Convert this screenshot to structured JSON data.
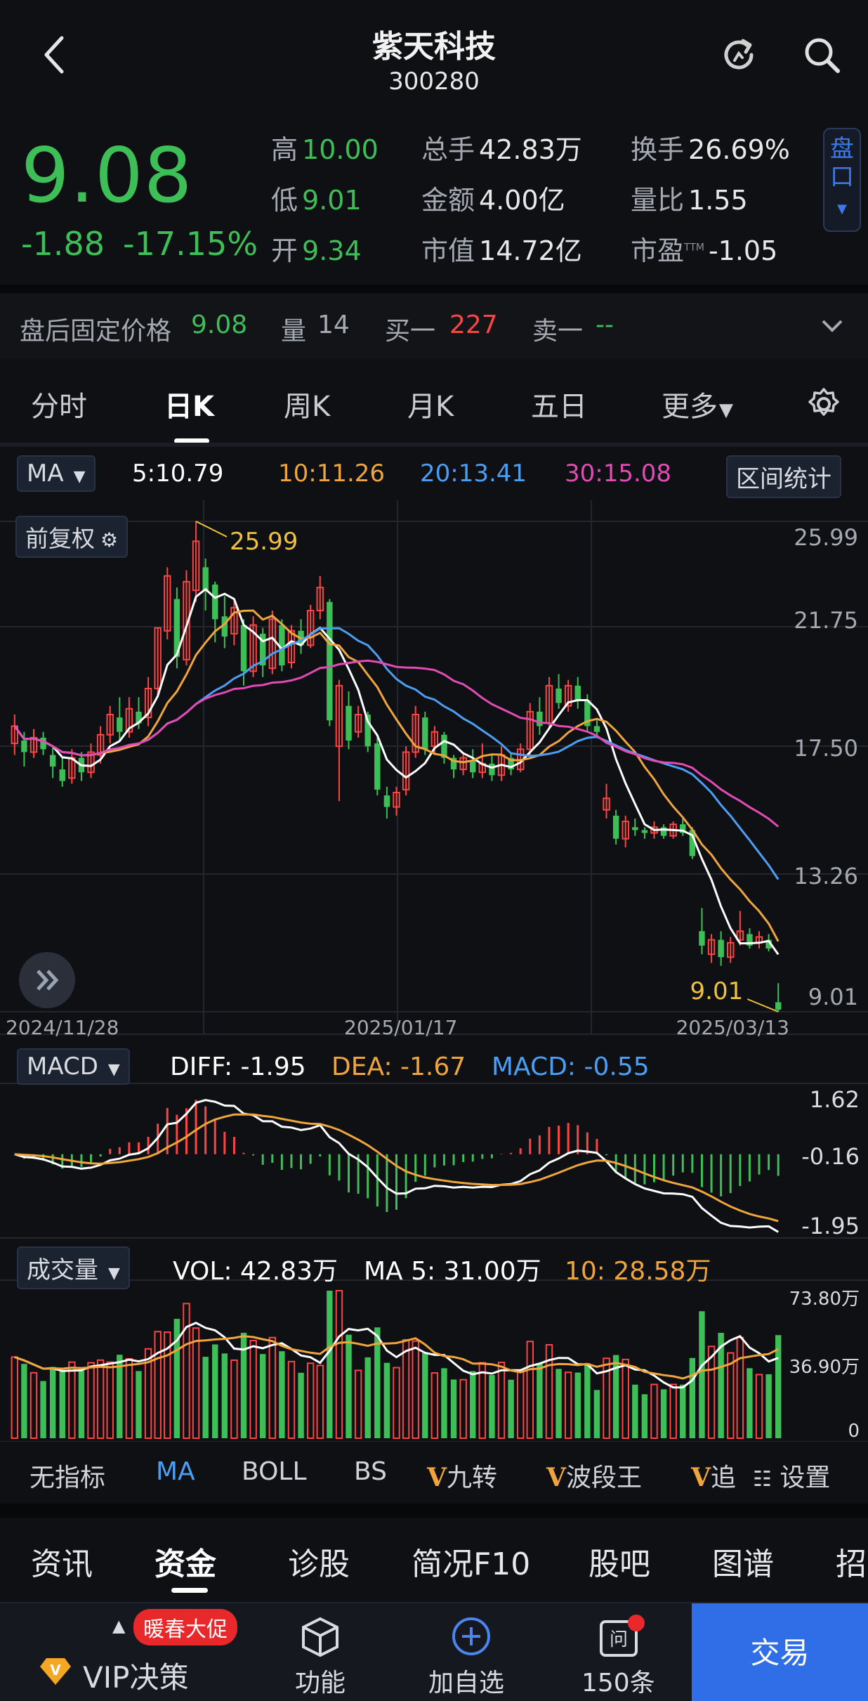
{
  "nav": {
    "title": "紫天科技",
    "code": "300280"
  },
  "quote": {
    "price": "9.08",
    "change": "-1.88",
    "change_pct": "-17.15%",
    "high_label": "高",
    "high": "10.00",
    "low_label": "低",
    "low": "9.01",
    "open_label": "开",
    "open": "9.34",
    "vol_label": "总手",
    "vol": "42.83万",
    "amount_label": "金额",
    "amount": "4.00亿",
    "mcap_label": "市值",
    "mcap": "14.72亿",
    "turnover_label": "换手",
    "turnover": "26.69%",
    "ratio_label": "量比",
    "ratio": "1.55",
    "pe_label": "市盈",
    "pe_sup": "TTM",
    "pe": "-1.05",
    "pankou": "盘口"
  },
  "after_hours": {
    "label": "盘后固定价格",
    "price": "9.08",
    "vol_label": "量",
    "vol": "14",
    "buy_label": "买一",
    "buy": "227",
    "sell_label": "卖一",
    "sell": "--"
  },
  "tabs": [
    "分时",
    "日K",
    "周K",
    "月K",
    "五日",
    "更多"
  ],
  "ma_row": {
    "selector": "MA",
    "ma5": "5:10.79",
    "ma10": "10:11.26",
    "ma20": "20:13.41",
    "ma30": "30:15.08",
    "range_btn": "区间统计"
  },
  "kline": {
    "adjust": "前复权",
    "max_label": "25.99",
    "min_label": "9.01",
    "y_ticks": [
      "25.99",
      "21.75",
      "17.50",
      "13.26",
      "9.01"
    ],
    "dates": [
      "2024/11/28",
      "2025/01/17",
      "2025/03/13"
    ]
  },
  "macd": {
    "selector": "MACD",
    "diff": "DIFF: -1.95",
    "dea": "DEA: -1.67",
    "macd": "MACD: -0.55",
    "ticks": [
      "1.62",
      "-0.16",
      "-1.95"
    ]
  },
  "volume": {
    "selector": "成交量",
    "vol": "VOL: 42.83万",
    "ma5": "MA 5: 31.00万",
    "ma10": "10: 28.58万",
    "ticks": [
      "73.80万",
      "36.90万",
      "0"
    ]
  },
  "indicators": [
    "无指标",
    "MA",
    "BOLL",
    "BS",
    "九转",
    "波段王",
    "追",
    "设置"
  ],
  "indicator_prefix": "V",
  "footer_tabs": [
    "资讯",
    "资金",
    "诊股",
    "简况F10",
    "股吧",
    "图谱",
    "招"
  ],
  "bottom_bar": {
    "vip": "VIP决策",
    "promo": "暖春大促",
    "func": "功能",
    "add": "加自选",
    "news": "150条",
    "trade": "交易"
  },
  "colors": {
    "up": "#ff4444",
    "down": "#3dbe57",
    "ma5": "#ffffff",
    "ma10": "#f0a53c",
    "ma20": "#4a9ff5",
    "ma30": "#e34bb4",
    "accent": "#2f6ee6"
  },
  "chart_data": {
    "type": "candlestick",
    "ylim": [
      9.01,
      25.99
    ],
    "candles": [
      {
        "o": 18.3,
        "c": 18.9,
        "h": 19.3,
        "l": 17.9
      },
      {
        "o": 18.4,
        "c": 18.0,
        "h": 18.7,
        "l": 17.5
      },
      {
        "o": 18.0,
        "c": 18.5,
        "h": 18.8,
        "l": 17.8
      },
      {
        "o": 18.5,
        "c": 18.1,
        "h": 18.7,
        "l": 17.9
      },
      {
        "o": 17.9,
        "c": 17.5,
        "h": 18.2,
        "l": 17.1
      },
      {
        "o": 17.4,
        "c": 17.0,
        "h": 17.8,
        "l": 16.8
      },
      {
        "o": 17.1,
        "c": 17.8,
        "h": 18.1,
        "l": 16.9
      },
      {
        "o": 17.8,
        "c": 17.3,
        "h": 18.0,
        "l": 17.0
      },
      {
        "o": 17.3,
        "c": 18.0,
        "h": 18.3,
        "l": 17.1
      },
      {
        "o": 17.9,
        "c": 18.6,
        "h": 18.9,
        "l": 17.6
      },
      {
        "o": 18.6,
        "c": 19.3,
        "h": 19.6,
        "l": 18.3
      },
      {
        "o": 19.2,
        "c": 18.7,
        "h": 19.9,
        "l": 18.4
      },
      {
        "o": 18.7,
        "c": 19.5,
        "h": 19.9,
        "l": 18.5
      },
      {
        "o": 19.4,
        "c": 19.0,
        "h": 19.9,
        "l": 18.8
      },
      {
        "o": 19.2,
        "c": 20.2,
        "h": 20.6,
        "l": 18.9
      },
      {
        "o": 20.2,
        "c": 22.3,
        "h": 22.3,
        "l": 20.0
      },
      {
        "o": 22.2,
        "c": 24.1,
        "h": 24.4,
        "l": 21.9
      },
      {
        "o": 23.3,
        "c": 21.3,
        "h": 23.7,
        "l": 20.9
      },
      {
        "o": 21.2,
        "c": 23.9,
        "h": 24.3,
        "l": 21.0
      },
      {
        "o": 23.6,
        "c": 25.3,
        "h": 25.99,
        "l": 23.2
      },
      {
        "o": 24.4,
        "c": 23.6,
        "h": 24.7,
        "l": 22.9
      },
      {
        "o": 23.8,
        "c": 22.6,
        "h": 23.9,
        "l": 21.8
      },
      {
        "o": 22.7,
        "c": 22.0,
        "h": 23.4,
        "l": 21.6
      },
      {
        "o": 22.1,
        "c": 23.0,
        "h": 23.3,
        "l": 21.7
      },
      {
        "o": 22.4,
        "c": 20.8,
        "h": 22.6,
        "l": 20.3
      },
      {
        "o": 20.8,
        "c": 22.4,
        "h": 22.7,
        "l": 20.6
      },
      {
        "o": 22.1,
        "c": 21.0,
        "h": 22.3,
        "l": 20.6
      },
      {
        "o": 20.9,
        "c": 22.6,
        "h": 22.9,
        "l": 20.7
      },
      {
        "o": 22.4,
        "c": 21.0,
        "h": 22.6,
        "l": 20.8
      },
      {
        "o": 21.1,
        "c": 22.2,
        "h": 22.4,
        "l": 20.9
      },
      {
        "o": 22.2,
        "c": 21.7,
        "h": 22.6,
        "l": 21.4
      },
      {
        "o": 21.7,
        "c": 22.9,
        "h": 23.1,
        "l": 21.6
      },
      {
        "o": 22.9,
        "c": 23.7,
        "h": 24.1,
        "l": 22.6
      },
      {
        "o": 23.2,
        "c": 19.1,
        "h": 23.3,
        "l": 18.9
      },
      {
        "o": 18.2,
        "c": 20.3,
        "h": 20.5,
        "l": 16.3
      },
      {
        "o": 19.6,
        "c": 18.4,
        "h": 20.1,
        "l": 18.1
      },
      {
        "o": 18.7,
        "c": 19.3,
        "h": 19.6,
        "l": 18.5
      },
      {
        "o": 19.3,
        "c": 18.2,
        "h": 19.4,
        "l": 18.0
      },
      {
        "o": 18.3,
        "c": 16.7,
        "h": 18.5,
        "l": 16.5
      },
      {
        "o": 16.5,
        "c": 16.1,
        "h": 16.8,
        "l": 15.7
      },
      {
        "o": 16.1,
        "c": 16.6,
        "h": 16.8,
        "l": 15.8
      },
      {
        "o": 16.7,
        "c": 18.0,
        "h": 18.2,
        "l": 16.5
      },
      {
        "o": 18.0,
        "c": 19.3,
        "h": 19.6,
        "l": 17.8
      },
      {
        "o": 19.2,
        "c": 18.1,
        "h": 19.4,
        "l": 17.9
      },
      {
        "o": 18.2,
        "c": 18.7,
        "h": 18.9,
        "l": 17.9
      },
      {
        "o": 18.6,
        "c": 17.8,
        "h": 18.7,
        "l": 17.6
      },
      {
        "o": 17.8,
        "c": 17.4,
        "h": 17.9,
        "l": 17.1
      },
      {
        "o": 17.4,
        "c": 17.8,
        "h": 18.0,
        "l": 17.2
      },
      {
        "o": 17.7,
        "c": 17.3,
        "h": 18.1,
        "l": 17.1
      },
      {
        "o": 17.3,
        "c": 17.6,
        "h": 18.3,
        "l": 17.1
      },
      {
        "o": 17.6,
        "c": 17.2,
        "h": 17.9,
        "l": 17.0
      },
      {
        "o": 17.2,
        "c": 17.9,
        "h": 18.2,
        "l": 17.0
      },
      {
        "o": 17.8,
        "c": 17.4,
        "h": 18.0,
        "l": 17.2
      },
      {
        "o": 17.4,
        "c": 18.1,
        "h": 18.3,
        "l": 17.3
      },
      {
        "o": 18.1,
        "c": 19.4,
        "h": 19.7,
        "l": 17.9
      },
      {
        "o": 19.4,
        "c": 18.9,
        "h": 19.9,
        "l": 18.6
      },
      {
        "o": 19.0,
        "c": 20.3,
        "h": 20.6,
        "l": 18.8
      },
      {
        "o": 20.2,
        "c": 19.7,
        "h": 20.7,
        "l": 19.5
      },
      {
        "o": 19.6,
        "c": 20.3,
        "h": 20.5,
        "l": 19.4
      },
      {
        "o": 20.3,
        "c": 19.8,
        "h": 20.6,
        "l": 19.5
      },
      {
        "o": 19.8,
        "c": 18.9,
        "h": 20.0,
        "l": 18.7
      },
      {
        "o": 18.9,
        "c": 18.7,
        "h": 19.1,
        "l": 18.5
      },
      {
        "o": 16.0,
        "c": 16.4,
        "h": 16.9,
        "l": 15.7
      },
      {
        "o": 15.8,
        "c": 15.0,
        "h": 16.0,
        "l": 14.8
      },
      {
        "o": 15.0,
        "c": 15.6,
        "h": 15.8,
        "l": 14.7
      },
      {
        "o": 15.4,
        "c": 15.3,
        "h": 15.7,
        "l": 15.1
      },
      {
        "o": 15.3,
        "c": 15.2,
        "h": 15.4,
        "l": 15.0
      },
      {
        "o": 15.2,
        "c": 15.4,
        "h": 15.6,
        "l": 15.0
      },
      {
        "o": 15.4,
        "c": 15.1,
        "h": 15.5,
        "l": 15.0
      },
      {
        "o": 15.1,
        "c": 15.5,
        "h": 15.6,
        "l": 15.0
      },
      {
        "o": 15.5,
        "c": 15.2,
        "h": 15.7,
        "l": 15.1
      },
      {
        "o": 15.3,
        "c": 14.4,
        "h": 15.4,
        "l": 14.3
      },
      {
        "o": 11.8,
        "c": 11.3,
        "h": 12.6,
        "l": 11.0
      },
      {
        "o": 11.0,
        "c": 11.5,
        "h": 11.7,
        "l": 10.7
      },
      {
        "o": 11.5,
        "c": 10.9,
        "h": 11.8,
        "l": 10.6
      },
      {
        "o": 10.9,
        "c": 11.4,
        "h": 11.6,
        "l": 10.7
      },
      {
        "o": 11.5,
        "c": 11.8,
        "h": 12.5,
        "l": 11.3
      },
      {
        "o": 11.7,
        "c": 11.3,
        "h": 11.9,
        "l": 11.2
      },
      {
        "o": 11.4,
        "c": 11.6,
        "h": 11.8,
        "l": 11.2
      },
      {
        "o": 11.5,
        "c": 11.2,
        "h": 11.7,
        "l": 11.1
      },
      {
        "o": 9.34,
        "c": 9.08,
        "h": 10.0,
        "l": 9.01
      }
    ]
  }
}
